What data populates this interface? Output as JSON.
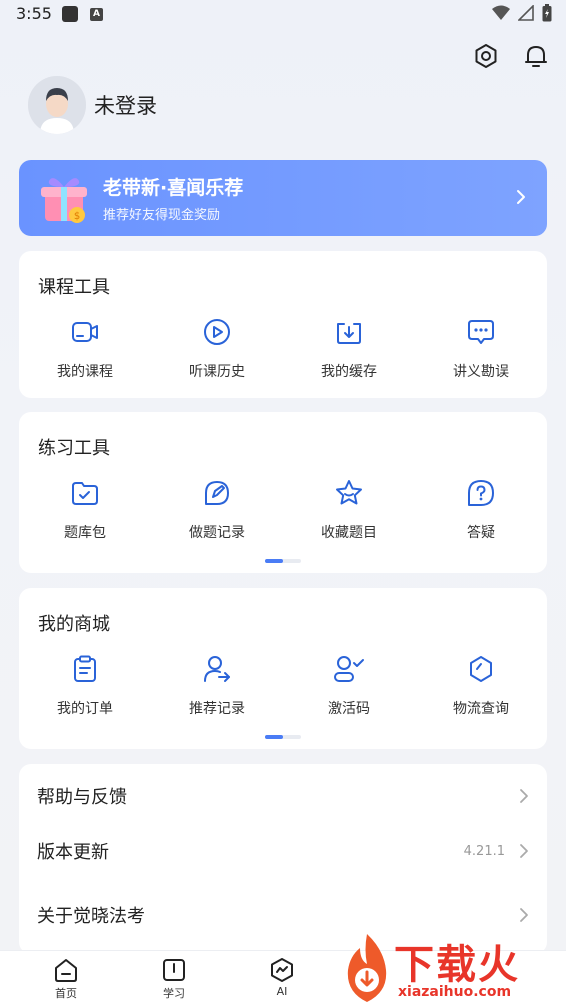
{
  "status_bar": {
    "time": "3:55",
    "badge": "A"
  },
  "profile": {
    "name": "未登录"
  },
  "banner": {
    "title": "老带新·喜闻乐荐",
    "subtitle": "推荐好友得现金奖励"
  },
  "course_tools": {
    "title": "课程工具",
    "items": [
      {
        "label": "我的课程",
        "icon": "video-icon"
      },
      {
        "label": "听课历史",
        "icon": "play-circle-icon"
      },
      {
        "label": "我的缓存",
        "icon": "download-icon"
      },
      {
        "label": "讲义勘误",
        "icon": "chat-dots-icon"
      }
    ]
  },
  "practice_tools": {
    "title": "练习工具",
    "items": [
      {
        "label": "题库包",
        "icon": "folder-icon"
      },
      {
        "label": "做题记录",
        "icon": "edit-record-icon"
      },
      {
        "label": "收藏题目",
        "icon": "star-icon"
      },
      {
        "label": "答疑",
        "icon": "question-icon"
      }
    ]
  },
  "mall": {
    "title": "我的商城",
    "items": [
      {
        "label": "我的订单",
        "icon": "clipboard-icon"
      },
      {
        "label": "推荐记录",
        "icon": "user-arrow-icon"
      },
      {
        "label": "激活码",
        "icon": "user-check-icon"
      },
      {
        "label": "物流查询",
        "icon": "hexagon-icon"
      }
    ]
  },
  "list": {
    "help": "帮助与反馈",
    "update": "版本更新",
    "version": "4.21.1",
    "about": "关于觉晓法考"
  },
  "tabbar": {
    "home": "首页",
    "study": "学习",
    "ai": "AI"
  },
  "watermark": {
    "text": "下载火",
    "url": "xiazaihuo.com"
  },
  "colors": {
    "accent": "#4a7cf5",
    "banner": "#7197ff",
    "icon": "#2a63d8"
  }
}
